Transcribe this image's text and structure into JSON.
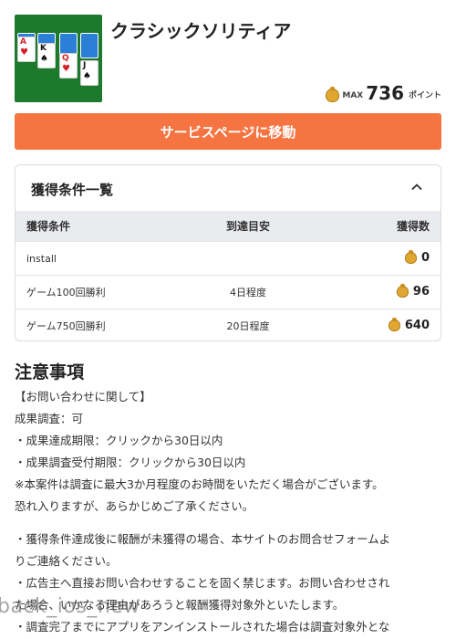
{
  "app": {
    "title": "クラシックソリティア",
    "max_label": "MAX",
    "max_points": "736",
    "points_unit": "ポイント",
    "icon_cards": [
      {
        "rank": "A",
        "suit": "♥",
        "color": "red"
      },
      {
        "rank": "K",
        "suit": "♠",
        "color": "black"
      },
      {
        "rank": "Q",
        "suit": "♥",
        "color": "red"
      },
      {
        "rank": "J",
        "suit": "♠",
        "color": "black"
      }
    ]
  },
  "service_button": {
    "label": "サービスページに移動"
  },
  "conditions": {
    "title": "獲得条件一覧",
    "columns": [
      "獲得条件",
      "到達目安",
      "獲得数"
    ],
    "rows": [
      {
        "condition": "install",
        "estimate": "",
        "points": "0"
      },
      {
        "condition": "ゲーム100回勝利",
        "estimate": "4日程度",
        "points": "96"
      },
      {
        "condition": "ゲーム750回勝利",
        "estimate": "20日程度",
        "points": "640"
      }
    ]
  },
  "notes": {
    "title": "注意事項",
    "lines_1": [
      "【お問い合わせに関して】",
      "成果調査：可",
      "・成果達成期限：クリックから30日以内",
      "・成果調査受付期限：クリックから30日以内",
      "※本案件は調査に最大3か月程度のお時間をいただく場合がございます。",
      "恐れ入りますが、あらかじめご了承ください。"
    ],
    "lines_2": [
      "・獲得条件達成後に報酬が未獲得の場合、本サイトのお問合せフォームよ",
      "りご連絡ください。",
      "・広告主へ直接お問い合わせすることを固く禁じます。お問い合わせされ",
      "た場合、いかなる理由があろうと報酬獲得対象外といたします。",
      "・調査完了までにアプリをアンインストールされた場合は調査対象外とな"
    ]
  },
  "overlay": {
    "back_label": "back_ios_new"
  },
  "colors": {
    "accent": "#f57442",
    "icon_green": "#1d7a2c",
    "coin": "#e0a733"
  }
}
